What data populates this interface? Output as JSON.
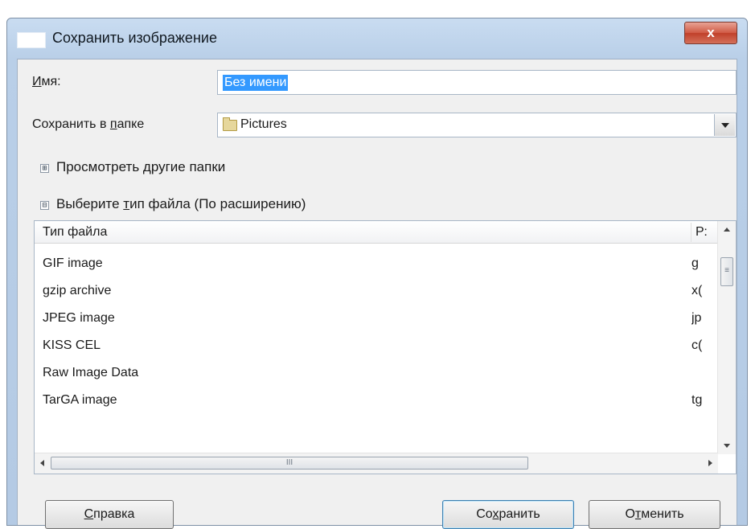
{
  "window": {
    "title": "Сохранить изображение",
    "close_label": "x"
  },
  "name_field": {
    "label_accel": "И",
    "label_rest": "мя:",
    "value": "Без имени"
  },
  "folder": {
    "label_pre": "Сохранить в ",
    "label_accel": "п",
    "label_post": "апке",
    "value": "Pictures"
  },
  "browse": {
    "expander": "⊞",
    "label": "Просмотреть другие папки"
  },
  "filetype": {
    "expander": "⊟",
    "label_pre": "Выберите ",
    "label_accel": "т",
    "label_post": "ип файла (По расширению)"
  },
  "file_list": {
    "columns": [
      "Тип файла",
      "Р:"
    ],
    "rows": [
      {
        "type": "GIF image",
        "ext": "g"
      },
      {
        "type": "gzip archive",
        "ext": "x("
      },
      {
        "type": "JPEG image",
        "ext": "jp"
      },
      {
        "type": "KISS CEL",
        "ext": "c("
      },
      {
        "type": "Raw Image Data",
        "ext": ""
      },
      {
        "type": "TarGA image",
        "ext": "tg"
      }
    ]
  },
  "buttons": {
    "help_accel": "С",
    "help_rest": "правка",
    "save_pre": "Со",
    "save_accel": "х",
    "save_post": "ранить",
    "cancel_pre": "О",
    "cancel_accel": "т",
    "cancel_post": "менить"
  },
  "colors": {
    "title_bar": "#b9cfe8",
    "close_button": "#c9503a",
    "selection": "#3399ff"
  }
}
